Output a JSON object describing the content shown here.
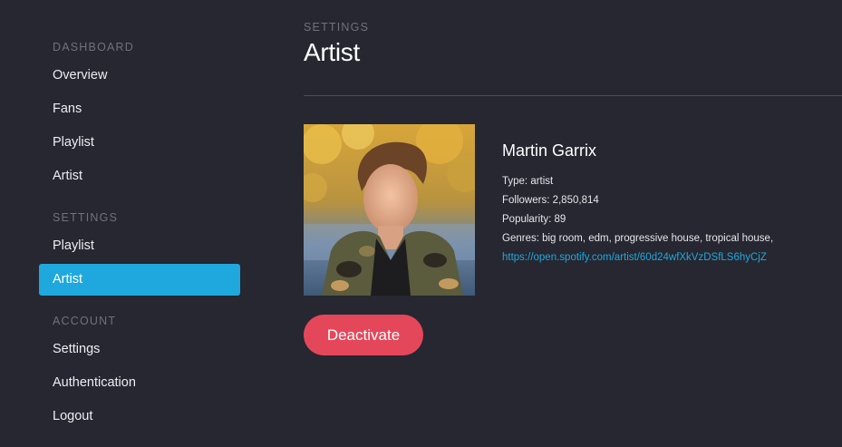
{
  "sidebar": {
    "sections": [
      {
        "title": "DASHBOARD",
        "items": [
          {
            "label": "Overview"
          },
          {
            "label": "Fans"
          },
          {
            "label": "Playlist"
          },
          {
            "label": "Artist"
          }
        ]
      },
      {
        "title": "SETTINGS",
        "items": [
          {
            "label": "Playlist"
          },
          {
            "label": "Artist",
            "active": true
          }
        ]
      },
      {
        "title": "ACCOUNT",
        "items": [
          {
            "label": "Settings"
          },
          {
            "label": "Authentication"
          },
          {
            "label": "Logout"
          }
        ]
      }
    ]
  },
  "header": {
    "breadcrumb": "SETTINGS",
    "title": "Artist"
  },
  "artist": {
    "name": "Martin Garrix",
    "photo_icon": "artist-photo",
    "type": "Type: artist",
    "followers": "Followers: 2,850,814",
    "popularity": "Popularity: 89",
    "genres": "Genres: big room, edm, progressive house, tropical house,",
    "url": "https://open.spotify.com/artist/60d24wfXkVzDSfLS6hyCjZ"
  },
  "actions": {
    "deactivate_label": "Deactivate"
  },
  "colors": {
    "background": "#262730",
    "accent": "#1fa8de",
    "danger": "#e5475a",
    "muted": "#6f717c"
  }
}
